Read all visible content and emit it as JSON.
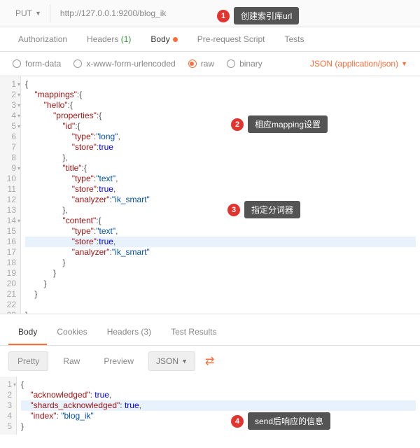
{
  "request": {
    "method": "PUT",
    "url": "http://127.0.0.1:9200/blog_ik"
  },
  "tabs": {
    "auth": "Authorization",
    "headers": "Headers",
    "headers_cnt": "(1)",
    "body": "Body",
    "prereq": "Pre-request Script",
    "tests": "Tests"
  },
  "body_types": {
    "form": "form-data",
    "url": "x-www-form-urlencoded",
    "raw": "raw",
    "bin": "binary",
    "ct": "JSON (application/json)"
  },
  "callouts": {
    "c1": "创建索引库url",
    "c2": "相应mapping设置",
    "c3": "指定分词器",
    "c4": "send后响应的信息"
  },
  "reqLines": [
    [
      [
        "p",
        "{"
      ]
    ],
    [
      [
        "p",
        "    "
      ],
      [
        "k",
        "\"mappings\""
      ],
      [
        "p",
        ":{"
      ]
    ],
    [
      [
        "p",
        "        "
      ],
      [
        "k",
        "\"hello\""
      ],
      [
        "p",
        ":{"
      ]
    ],
    [
      [
        "p",
        "            "
      ],
      [
        "k",
        "\"properties\""
      ],
      [
        "p",
        ":{"
      ]
    ],
    [
      [
        "p",
        "                "
      ],
      [
        "k",
        "\"id\""
      ],
      [
        "p",
        ":{"
      ]
    ],
    [
      [
        "p",
        "                    "
      ],
      [
        "k",
        "\"type\""
      ],
      [
        "p",
        ":"
      ],
      [
        "v",
        "\"long\""
      ],
      [
        "p",
        ","
      ]
    ],
    [
      [
        "p",
        "                    "
      ],
      [
        "k",
        "\"store\""
      ],
      [
        "p",
        ":"
      ],
      [
        "b",
        "true"
      ]
    ],
    [
      [
        "p",
        "                },"
      ]
    ],
    [
      [
        "p",
        "                "
      ],
      [
        "k",
        "\"title\""
      ],
      [
        "p",
        ":{"
      ]
    ],
    [
      [
        "p",
        "                    "
      ],
      [
        "k",
        "\"type\""
      ],
      [
        "p",
        ":"
      ],
      [
        "v",
        "\"text\""
      ],
      [
        "p",
        ","
      ]
    ],
    [
      [
        "p",
        "                    "
      ],
      [
        "k",
        "\"store\""
      ],
      [
        "p",
        ":"
      ],
      [
        "b",
        "true"
      ],
      [
        "p",
        ","
      ]
    ],
    [
      [
        "p",
        "                    "
      ],
      [
        "k",
        "\"analyzer\""
      ],
      [
        "p",
        ":"
      ],
      [
        "v",
        "\"ik_smart\""
      ]
    ],
    [
      [
        "p",
        "                },"
      ]
    ],
    [
      [
        "p",
        "                "
      ],
      [
        "k",
        "\"content\""
      ],
      [
        "p",
        ":{"
      ]
    ],
    [
      [
        "p",
        "                    "
      ],
      [
        "k",
        "\"type\""
      ],
      [
        "p",
        ":"
      ],
      [
        "v",
        "\"text\""
      ],
      [
        "p",
        ","
      ]
    ],
    [
      [
        "p",
        "                    "
      ],
      [
        "k",
        "\"store\""
      ],
      [
        "p",
        ":"
      ],
      [
        "b",
        "true"
      ],
      [
        "p",
        ","
      ]
    ],
    [
      [
        "p",
        "                    "
      ],
      [
        "k",
        "\"analyzer\""
      ],
      [
        "p",
        ":"
      ],
      [
        "v",
        "\"ik_smart\""
      ]
    ],
    [
      [
        "p",
        "                }"
      ]
    ],
    [
      [
        "p",
        "            }"
      ]
    ],
    [
      [
        "p",
        "        }"
      ]
    ],
    [
      [
        "p",
        "    }"
      ]
    ],
    [
      [
        "p",
        ""
      ]
    ],
    [
      [
        "p",
        "}"
      ]
    ]
  ],
  "reqFold": [
    1,
    2,
    3,
    4,
    5,
    9,
    14
  ],
  "reqHighlight": 16,
  "resp_tabs": {
    "body": "Body",
    "cookies": "Cookies",
    "headers": "Headers",
    "headers_cnt": "(3)",
    "tests": "Test Results"
  },
  "resp_tools": {
    "pretty": "Pretty",
    "raw": "Raw",
    "preview": "Preview",
    "fmt": "JSON"
  },
  "respLines": [
    [
      [
        "p",
        "{"
      ]
    ],
    [
      [
        "p",
        "    "
      ],
      [
        "k",
        "\"acknowledged\""
      ],
      [
        "p",
        ": "
      ],
      [
        "b",
        "true"
      ],
      [
        "p",
        ","
      ]
    ],
    [
      [
        "p",
        "    "
      ],
      [
        "k",
        "\"shards_acknowledged\""
      ],
      [
        "p",
        ": "
      ],
      [
        "b",
        "true"
      ],
      [
        "p",
        ","
      ]
    ],
    [
      [
        "p",
        "    "
      ],
      [
        "k",
        "\"index\""
      ],
      [
        "p",
        ": "
      ],
      [
        "v",
        "\"blog_ik\""
      ]
    ],
    [
      [
        "p",
        "}"
      ]
    ]
  ],
  "respFold": [
    1
  ],
  "respHighlight": 3
}
